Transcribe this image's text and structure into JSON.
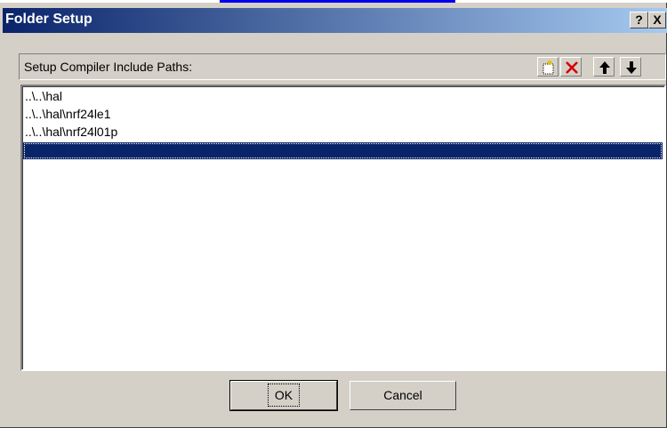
{
  "window": {
    "title": "Folder Setup",
    "help_label": "?",
    "close_label": "X"
  },
  "panel": {
    "header_label": "Setup Compiler Include Paths:",
    "toolbar": [
      {
        "name": "new-folder-icon",
        "tooltip": "New (Insert)"
      },
      {
        "name": "delete-icon",
        "tooltip": "Delete"
      },
      {
        "name": "move-up-icon",
        "tooltip": "Move Up"
      },
      {
        "name": "move-down-icon",
        "tooltip": "Move Down"
      }
    ]
  },
  "paths": [
    "..\\..\\hal",
    "..\\..\\hal\\nrf24le1",
    "..\\..\\hal\\nrf24l01p",
    ""
  ],
  "selected_index": 3,
  "buttons": {
    "ok": "OK",
    "cancel": "Cancel"
  },
  "colors": {
    "title_gradient_start": "#0a246a",
    "title_gradient_end": "#a6caf0",
    "selection": "#0a246a",
    "dialog_face": "#d4d0c8",
    "delete_icon": "#d40000"
  }
}
